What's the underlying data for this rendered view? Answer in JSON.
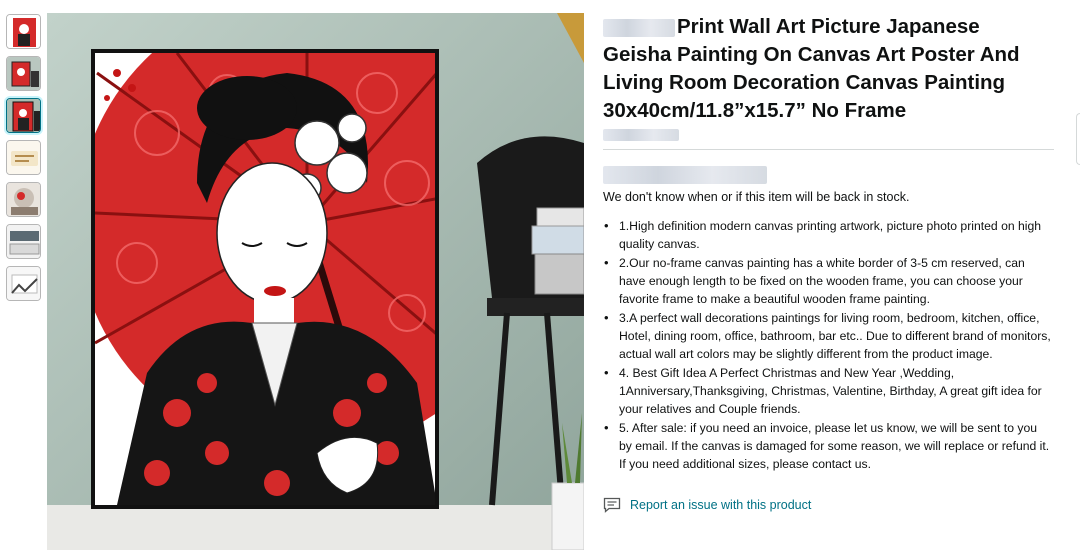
{
  "thumbnails": [
    {
      "name": "geisha-front"
    },
    {
      "name": "geisha-wall"
    },
    {
      "name": "geisha-selected"
    },
    {
      "name": "packaging-note"
    },
    {
      "name": "room-scene"
    },
    {
      "name": "rolled-canvas"
    },
    {
      "name": "canvas-detail"
    }
  ],
  "product": {
    "title": "Print Wall Art Picture Japanese Geisha Painting On Canvas Art Poster And Living Room Decoration Canvas Painting 30x40cm/11.8”x15.7” No Frame",
    "stock_message": "We don't know when or if this item will be back in stock.",
    "bullets": [
      "1.High definition modern canvas printing artwork, picture photo printed on high quality canvas.",
      "2.Our no-frame canvas painting has a white border of 3-5 cm reserved, can have enough length to be fixed on the wooden frame, you can choose your favorite frame to make a beautiful wooden frame painting.",
      "3.A perfect wall decorations paintings for living room, bedroom, kitchen, office, Hotel, dining room, office, bathroom, bar etc.. Due to different brand of monitors, actual wall art colors may be slightly different from the product image.",
      "4. Best Gift Idea A Perfect Christmas and New Year ,Wedding, 1Anniversary,Thanksgiving, Christmas, Valentine, Birthday, A great gift idea for your relatives and Couple friends.",
      "5. After sale: if you need an invoice, please let us know, we will be sent to you by email. If the canvas is damaged for some reason, we will replace or refund it. If you need additional sizes, please contact us."
    ],
    "report_link": "Report an issue with this product"
  },
  "colors": {
    "link": "#007185",
    "umbrella_red": "#d42a2a",
    "wall": "#a9bdb3"
  },
  "icons": {
    "report": "message-square-icon"
  }
}
